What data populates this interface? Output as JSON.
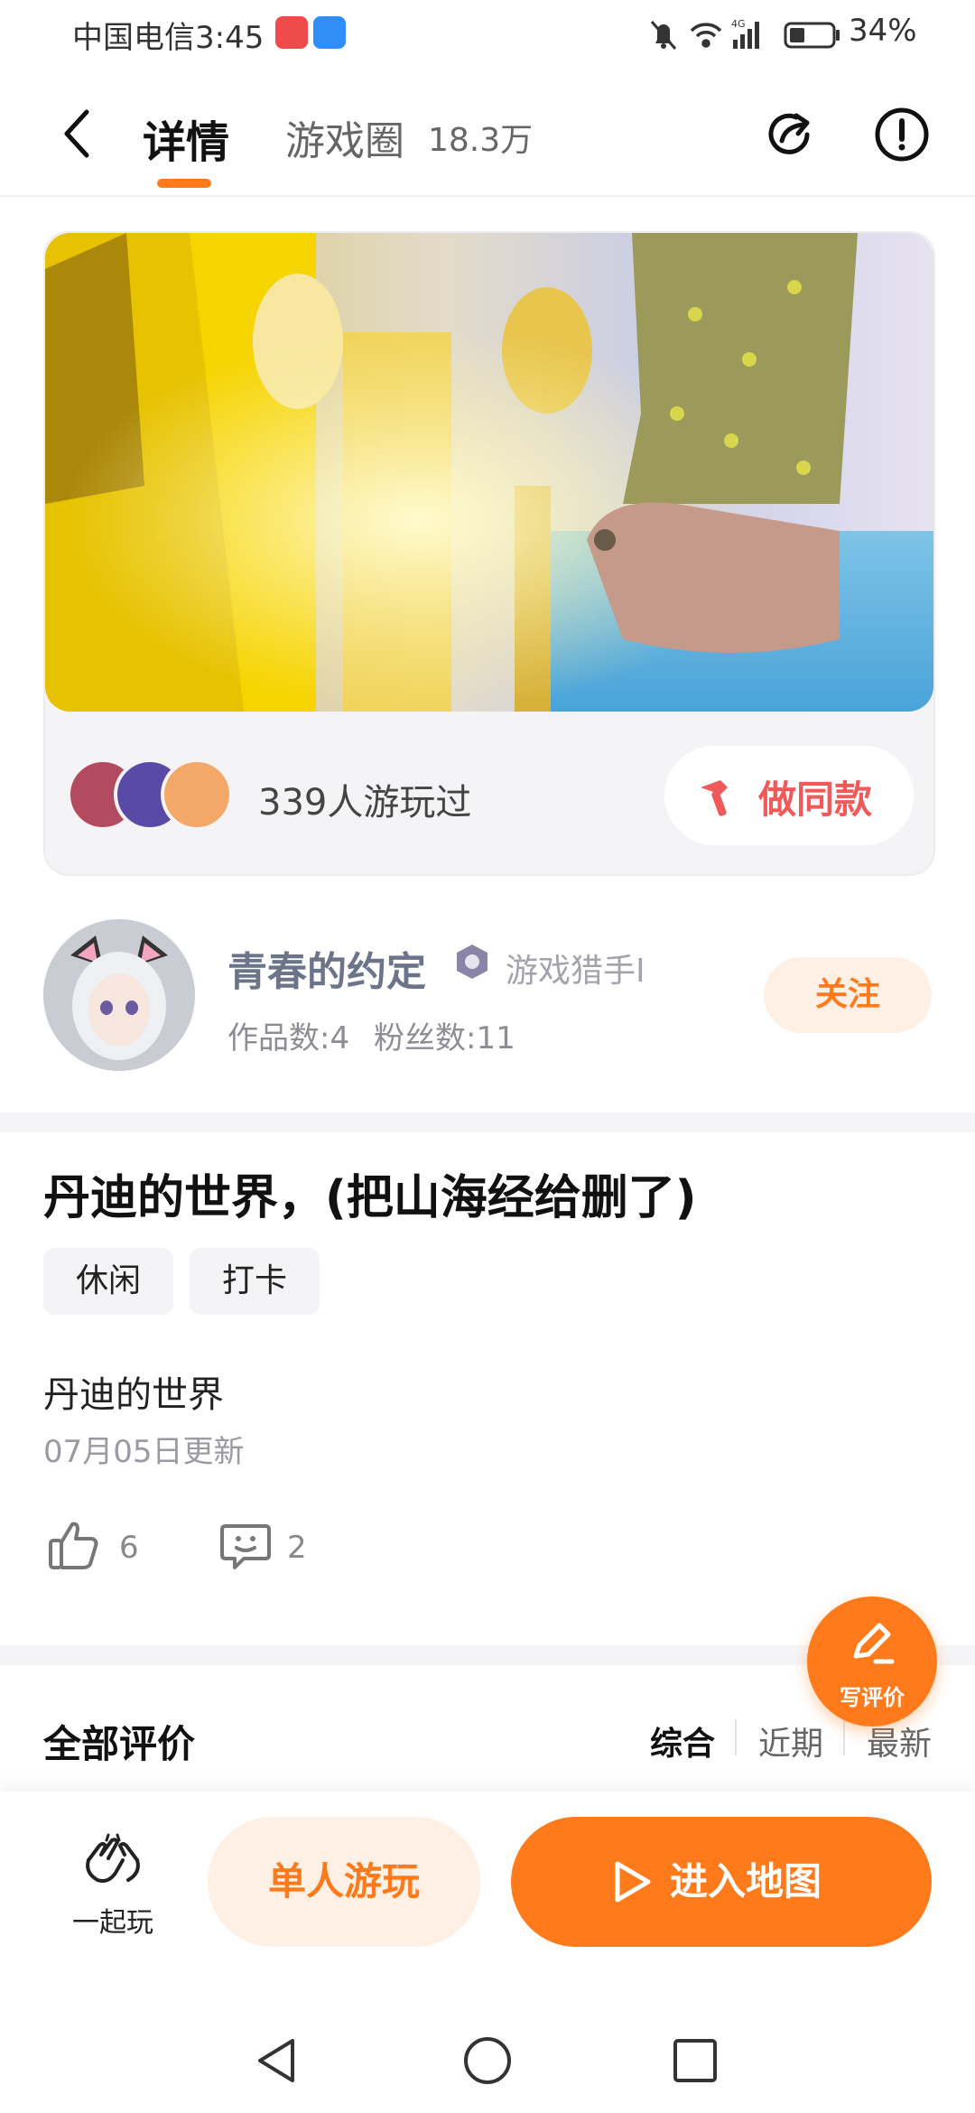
{
  "status_bar": {
    "carrier_time": "中国电信3:45",
    "battery": "34%",
    "icons": [
      "notifications-off-icon",
      "wifi-icon",
      "4g-signal-icon",
      "battery-icon"
    ]
  },
  "header": {
    "tabs": [
      {
        "label": "详情",
        "active": true
      },
      {
        "label": "游戏圈",
        "count": "18.3万",
        "active": false
      }
    ],
    "accent": "#ff7a1a"
  },
  "map_card": {
    "played_text": "339人游玩过",
    "make_same_label": "做同款"
  },
  "author": {
    "name": "青春的约定",
    "badge": "游戏猎手I",
    "works": "作品数:4",
    "fans": "粉丝数:11",
    "follow_label": "关注"
  },
  "detail": {
    "title": "丹迪的世界，(把山海经给删了)",
    "tags": [
      "休闲",
      "打卡"
    ],
    "description": "丹迪的世界",
    "updated": "07月05日更新",
    "likes": "6",
    "comments": "2"
  },
  "reviews": {
    "title": "全部评价",
    "sort_options": [
      {
        "label": "综合",
        "active": true
      },
      {
        "label": "近期",
        "active": false
      },
      {
        "label": "最新",
        "active": false
      }
    ],
    "write_label": "写评价"
  },
  "actions": {
    "together_label": "一起玩",
    "solo_label": "单人游玩",
    "enter_label": "进入地图"
  }
}
